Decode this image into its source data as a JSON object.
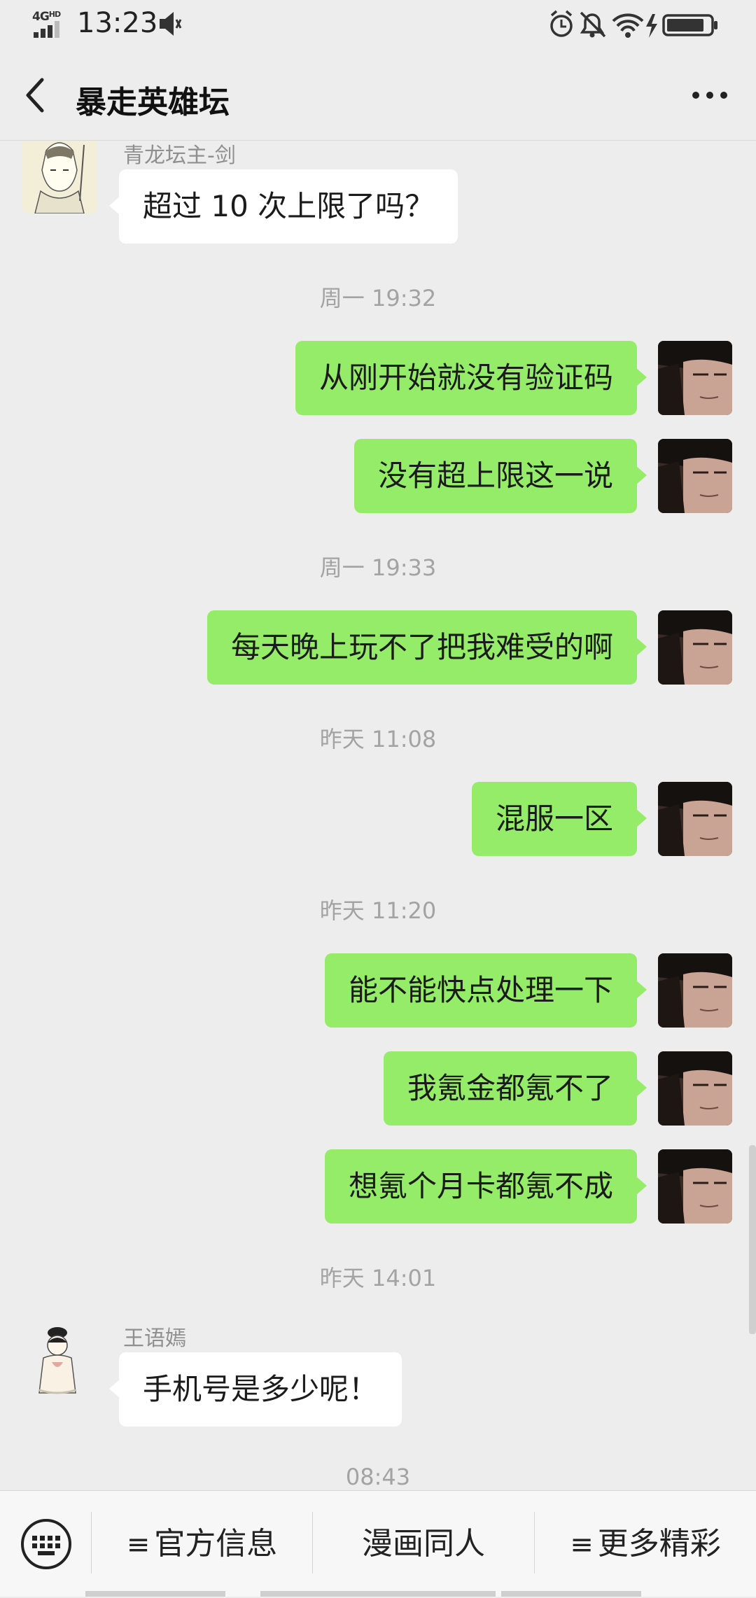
{
  "status_bar": {
    "network": "4G",
    "network_sup": "HD",
    "time": "13:23"
  },
  "header": {
    "title": "暴走英雄坛"
  },
  "chat": {
    "sender_1": "青龙坛主-剑",
    "msg_1": "超过 10 次上限了吗？",
    "time_1": "周一 19:32",
    "msg_2": "从刚开始就没有验证码",
    "msg_3": "没有超上限这一说",
    "time_2": "周一 19:33",
    "msg_4": "每天晚上玩不了把我难受的啊",
    "time_3": "昨天 11:08",
    "msg_5": "混服一区",
    "time_4": "昨天 11:20",
    "msg_6": "能不能快点处理一下",
    "msg_7": "我氪金都氪不了",
    "msg_8": "想氪个月卡都氪不成",
    "time_5": "昨天 14:01",
    "sender_2": "王语嫣",
    "msg_9": "手机号是多少呢！",
    "time_6": "08:43"
  },
  "bottom_menu": {
    "item_1": "官方信息",
    "item_2": "漫画同人",
    "item_3": "更多精彩",
    "menu_glyph": "≡"
  },
  "colors": {
    "outgoing_bubble": "#95ec69",
    "incoming_bubble": "#ffffff",
    "background": "#ededed"
  },
  "icons": [
    "signal-icon",
    "speaker-muted-icon",
    "alarm-icon",
    "bell-off-icon",
    "wifi-icon",
    "charging-icon",
    "battery-icon",
    "back-arrow-icon",
    "more-icon",
    "keyboard-icon"
  ]
}
